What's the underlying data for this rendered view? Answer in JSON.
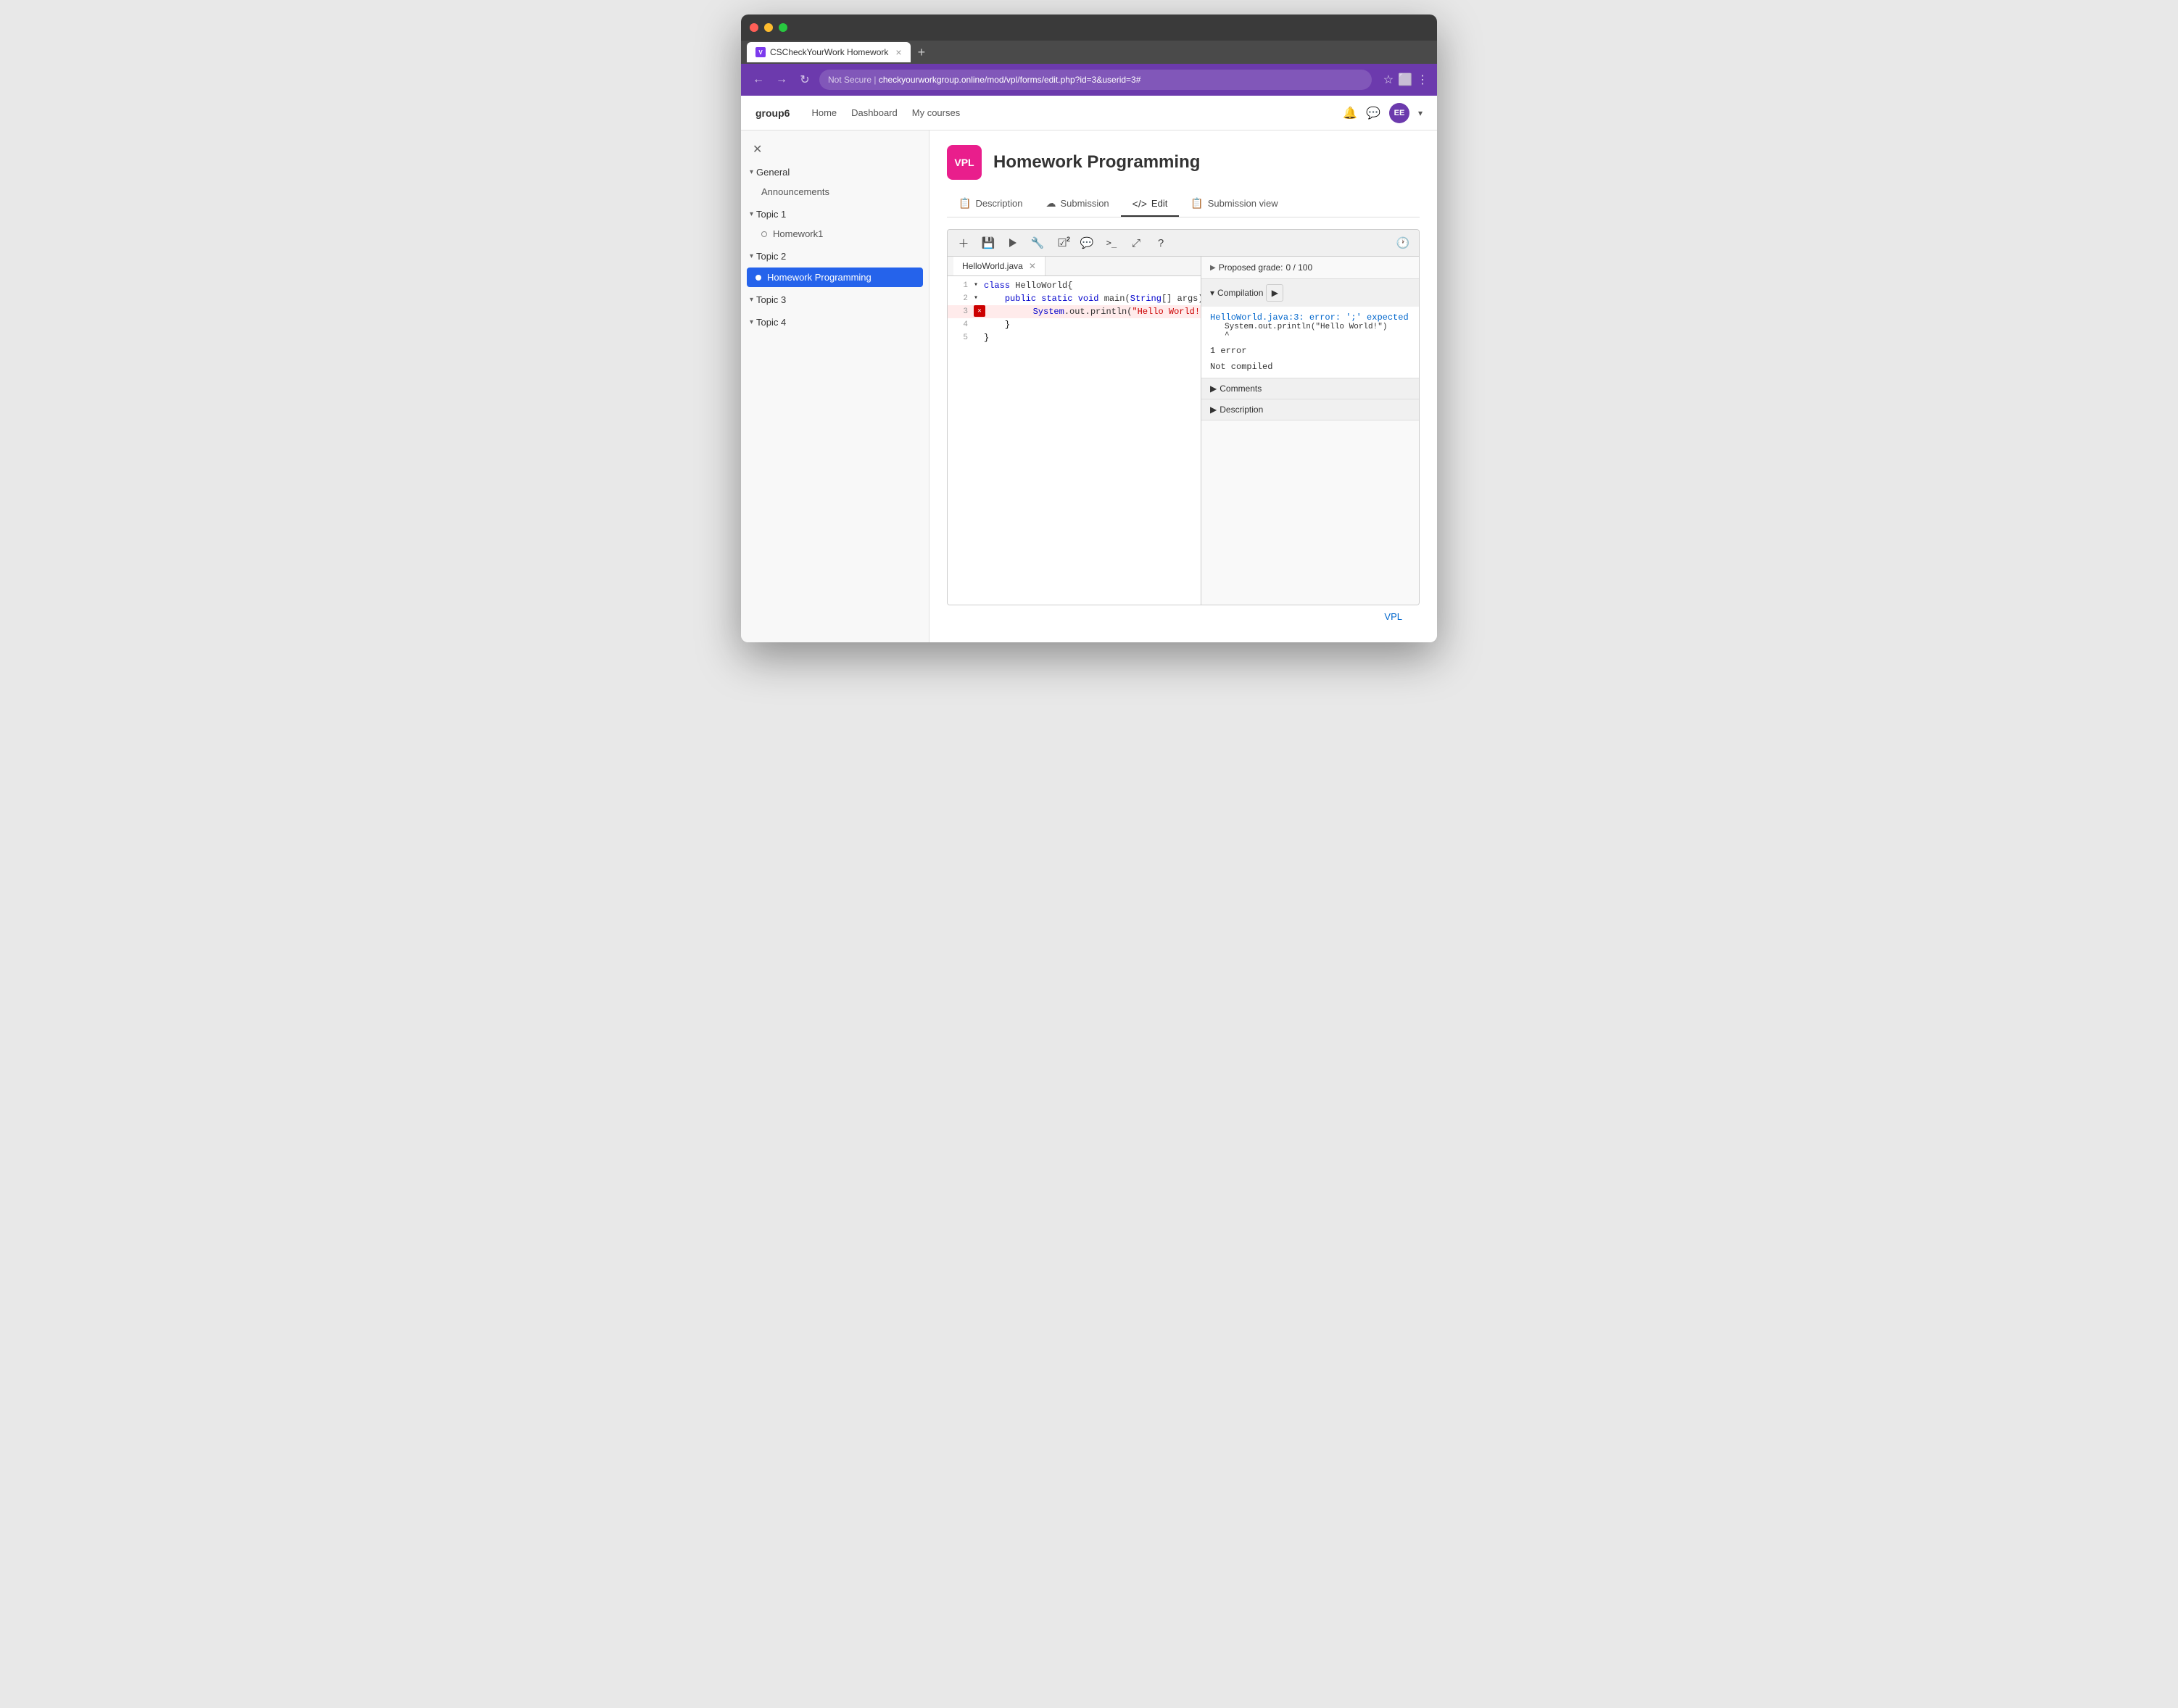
{
  "browser": {
    "tab_title": "CSCheckYourWork Homework",
    "url_secure_label": "Not Secure",
    "url_domain": "checkyourworkgroup.online",
    "url_path": "/mod/vpl/forms/edit.php?id=3&userid=3#",
    "new_tab_label": "+"
  },
  "nav": {
    "logo": "group6",
    "home": "Home",
    "dashboard": "Dashboard",
    "my_courses": "My courses",
    "user_initials": "EE"
  },
  "sidebar": {
    "close_label": "✕",
    "general_label": "General",
    "announcements_label": "Announcements",
    "topic1_label": "Topic 1",
    "homework1_label": "Homework1",
    "topic2_label": "Topic 2",
    "active_item_label": "Homework Programming",
    "topic3_label": "Topic 3",
    "topic4_label": "Topic 4"
  },
  "page": {
    "icon_label": "VPL",
    "title": "Homework Programming",
    "tab_description": "Description",
    "tab_submission": "Submission",
    "tab_edit": "Edit",
    "tab_submission_view": "Submission view"
  },
  "toolbar": {
    "btn_add": "＋",
    "btn_save": "💾",
    "btn_run": "▶",
    "btn_debug": "🔧",
    "btn_eval": "☑",
    "btn_chat": "💬",
    "btn_terminal": ">_",
    "btn_expand": "⤢",
    "btn_help": "?",
    "btn_clock": "🕐"
  },
  "editor": {
    "filename": "HelloWorld.java",
    "lines": [
      {
        "num": "1",
        "content": "class HelloWorld{",
        "error": false,
        "marker": false
      },
      {
        "num": "2",
        "content": "    public static void main(String[] args){",
        "error": false,
        "marker": false
      },
      {
        "num": "3",
        "content": "        System.out.println(\"Hello World!\")",
        "error": true,
        "marker": true
      },
      {
        "num": "4",
        "content": "    }",
        "error": false,
        "marker": false
      },
      {
        "num": "5",
        "content": "}",
        "error": false,
        "marker": false
      }
    ]
  },
  "results": {
    "proposed_grade_label": "Proposed grade:",
    "proposed_grade_value": "0 / 100",
    "compilation_label": "Compilation",
    "error_link": "HelloWorld.java:3: error: ';' expected",
    "error_line": "        System.out.println(\"Hello World!\")",
    "error_caret": "                                        ^",
    "error_count": "1 error",
    "not_compiled": "Not compiled",
    "comments_label": "Comments",
    "description_label": "Description"
  },
  "footer": {
    "vpl_label": "VPL"
  }
}
